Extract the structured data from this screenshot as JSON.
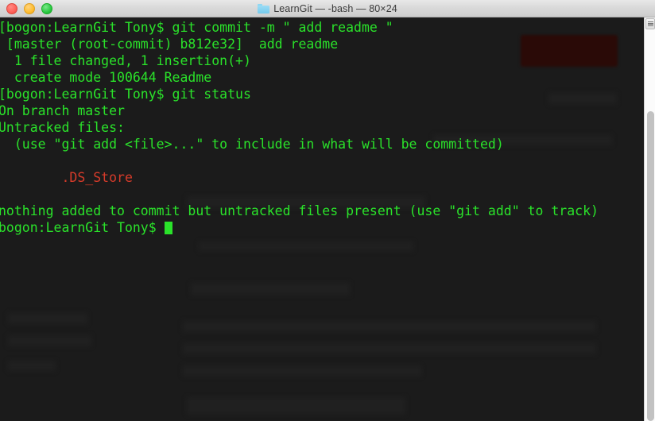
{
  "window": {
    "title": "LearnGit — -bash — 80×24",
    "folder_icon": "folder-icon",
    "controls": {
      "close_label": "close",
      "minimize_label": "minimize",
      "zoom_label": "zoom"
    },
    "colors": {
      "close": "#ff5f57",
      "minimize": "#febc2e",
      "zoom": "#28c840",
      "terminal_background": "#1b1b1b",
      "text_green": "#2ae22a",
      "text_red": "#d63b2a",
      "titlebar": "#d8d8d8"
    },
    "size": {
      "columns": 80,
      "rows": 24
    },
    "shell": "-bash",
    "directory": "LearnGit"
  },
  "terminal": {
    "prompt": "bogon:LearnGit Tony$ ",
    "lines": [
      {
        "text": "[bogon:LearnGit Tony$ git commit -m \" add readme \"",
        "color": "green"
      },
      {
        "text": " [master (root-commit) b812e32]  add readme",
        "color": "green"
      },
      {
        "text": "  1 file changed, 1 insertion(+)",
        "color": "green"
      },
      {
        "text": "  create mode 100644 Readme",
        "color": "green"
      },
      {
        "text": "[bogon:LearnGit Tony$ git status",
        "color": "green"
      },
      {
        "text": "On branch master",
        "color": "green"
      },
      {
        "text": "Untracked files:",
        "color": "green"
      },
      {
        "text": "  (use \"git add <file>...\" to include in what will be committed)",
        "color": "green"
      },
      {
        "text": "",
        "color": "green"
      },
      {
        "text": "        .DS_Store",
        "color": "red"
      },
      {
        "text": "",
        "color": "green"
      },
      {
        "text": "nothing added to commit but untracked files present (use \"git add\" to track)",
        "color": "green"
      },
      {
        "text": "bogon:LearnGit Tony$ ",
        "color": "green",
        "cursor": true
      }
    ]
  },
  "scrollbar": {
    "button_label": "scroll-menu-button",
    "thumb_label": "scrollbar-thumb"
  }
}
